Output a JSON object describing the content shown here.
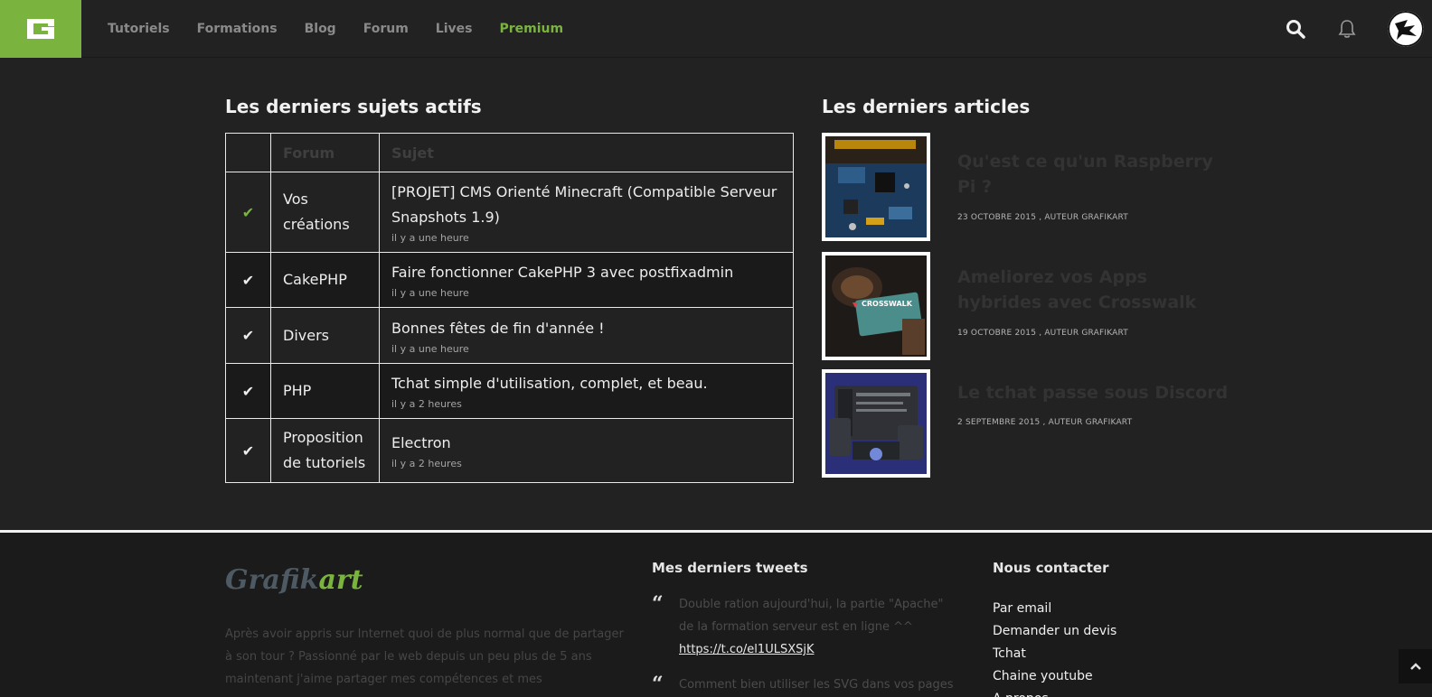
{
  "header": {
    "nav": [
      {
        "label": "Tutoriels"
      },
      {
        "label": "Formations"
      },
      {
        "label": "Blog"
      },
      {
        "label": "Forum"
      },
      {
        "label": "Lives"
      },
      {
        "label": "Premium"
      }
    ]
  },
  "topics": {
    "title": "Les derniers sujets actifs",
    "columns": {
      "forum": "Forum",
      "subject": "Sujet"
    },
    "rows": [
      {
        "forum": "Vos créations",
        "subject": "[PROJET] CMS Orienté Minecraft (Compatible Serveur Snapshots 1.9)",
        "ago": "il y a une heure"
      },
      {
        "forum": "CakePHP",
        "subject": "Faire fonctionner CakePHP 3 avec postfixadmin",
        "ago": "il y a une heure"
      },
      {
        "forum": "Divers",
        "subject": "Bonnes fêtes de fin d'année !",
        "ago": "il y a une heure"
      },
      {
        "forum": "PHP",
        "subject": "Tchat simple d'utilisation, complet, et beau.",
        "ago": "il y a 2 heures"
      },
      {
        "forum": "Proposition de tutoriels",
        "subject": "Electron",
        "ago": "il y a 2 heures"
      }
    ]
  },
  "articles": {
    "title": "Les derniers articles",
    "items": [
      {
        "title": "Qu'est ce qu'un Raspberry Pi ?",
        "meta": "23 OCTOBRE 2015 , AUTEUR GRAFIKART"
      },
      {
        "title": "Ameliorez vos Apps hybrides avec Crosswalk",
        "meta": "19 OCTOBRE 2015 , AUTEUR GRAFIKART",
        "thumb_text": "CROSSWALK"
      },
      {
        "title": "Le tchat passe sous Discord",
        "meta": "2 SEPTEMBRE 2015 , AUTEUR GRAFIKART"
      }
    ]
  },
  "footer": {
    "brand_part1": "Grafik",
    "brand_part2": "art",
    "about": "Après avoir appris sur Internet quoi de plus normal que de partager à son tour ? Passionné par le web depuis un peu plus de 5 ans maintenant j'aime partager mes compétences et mes",
    "tweets_title": "Mes derniers tweets",
    "tweets": [
      {
        "text": "Double ration aujourd'hui, la partie \"Apache\" de la formation serveur est en ligne ^^",
        "link": "https://t.co/el1ULSXSjK"
      },
      {
        "text": "Comment bien utiliser les SVG dans vos pages"
      }
    ],
    "contact_title": "Nous contacter",
    "contact_links": [
      "Par email",
      "Demander un devis",
      "Tchat",
      "Chaine youtube",
      "A propos"
    ]
  },
  "colors": {
    "accent": "#7ab43f",
    "background": "#222222",
    "footer_bg": "#1b1b1b"
  }
}
